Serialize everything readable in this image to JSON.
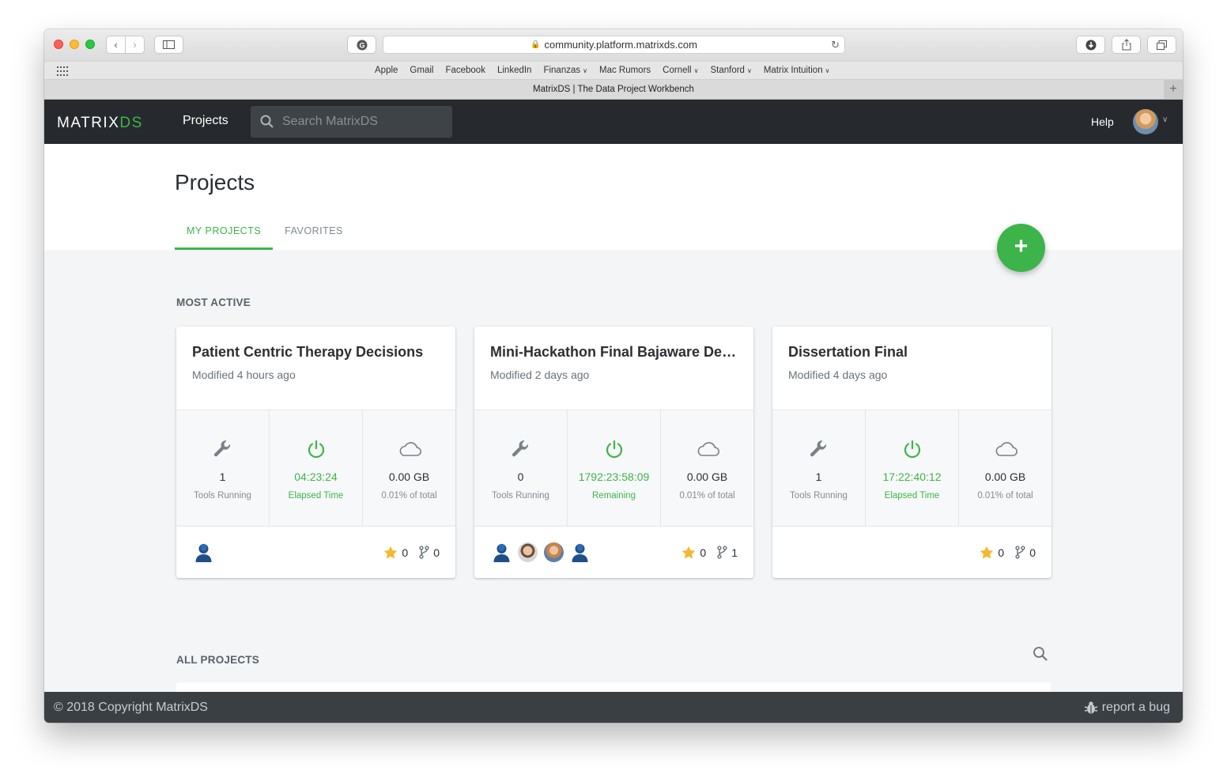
{
  "browser": {
    "url": "community.platform.matrixds.com",
    "tab_title": "MatrixDS | The Data Project Workbench",
    "bookmarks": [
      {
        "label": "Apple",
        "caret": false
      },
      {
        "label": "Gmail",
        "caret": false
      },
      {
        "label": "Facebook",
        "caret": false
      },
      {
        "label": "LinkedIn",
        "caret": false
      },
      {
        "label": "Finanzas",
        "caret": true
      },
      {
        "label": "Mac Rumors",
        "caret": false
      },
      {
        "label": "Cornell",
        "caret": true
      },
      {
        "label": "Stanford",
        "caret": true
      },
      {
        "label": "Matrix Intuition",
        "caret": true
      }
    ]
  },
  "header": {
    "logo_main": "MATRIX",
    "logo_accent": "DS",
    "nav_projects": "Projects",
    "search_placeholder": "Search MatrixDS",
    "help": "Help"
  },
  "page": {
    "title": "Projects",
    "tabs": [
      {
        "label": "MY PROJECTS",
        "active": true
      },
      {
        "label": "FAVORITES",
        "active": false
      }
    ],
    "add_button": "+",
    "most_active_label": "MOST ACTIVE",
    "all_projects_label": "ALL PROJECTS"
  },
  "colors": {
    "accent": "#3cb44a",
    "header_bg": "#262a2e",
    "footer_bg": "#3a3f44"
  },
  "cards": [
    {
      "title": "Patient Centric Therapy Decisions",
      "modified": "Modified 4 hours ago",
      "tools_value": "1",
      "tools_label": "Tools Running",
      "time_value": "04:23:24",
      "time_label": "Elapsed Time",
      "storage_value": "0.00 GB",
      "storage_label": "0.01% of total",
      "stars": "0",
      "forks": "0",
      "members": [
        "user-icon"
      ]
    },
    {
      "title": "Mini-Hackathon Final Bajaware Deliv...",
      "modified": "Modified 2 days ago",
      "tools_value": "0",
      "tools_label": "Tools Running",
      "time_value": "1792:23:58:09",
      "time_label": "Remaining",
      "storage_value": "0.00 GB",
      "storage_label": "0.01% of total",
      "stars": "0",
      "forks": "1",
      "members": [
        "user-icon",
        "photo-avatar-a",
        "photo-avatar-b",
        "user-icon"
      ]
    },
    {
      "title": "Dissertation Final",
      "modified": "Modified 4 days ago",
      "tools_value": "1",
      "tools_label": "Tools Running",
      "time_value": "17:22:40:12",
      "time_label": "Elapsed Time",
      "storage_value": "0.00 GB",
      "storage_label": "0.01% of total",
      "stars": "0",
      "forks": "0",
      "members": []
    }
  ],
  "footer": {
    "copyright": "© 2018 Copyright MatrixDS",
    "report_bug": "report a bug"
  }
}
